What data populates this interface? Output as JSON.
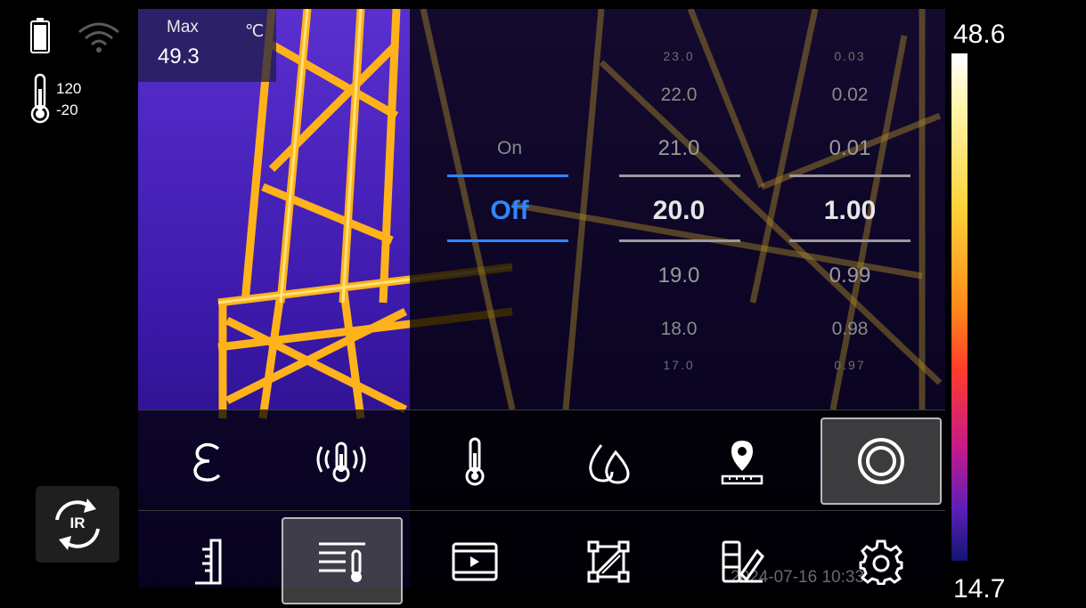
{
  "status": {
    "battery_icon": "battery-icon",
    "wifi_icon": "wifi-icon",
    "range_icon": "thermometer-icon",
    "range_high": "120",
    "range_low": "-20"
  },
  "readout": {
    "label": "Max",
    "value": "49.3",
    "unit": "℃"
  },
  "picker": {
    "toggle": {
      "above": "On",
      "selected": "Off"
    },
    "reflected_temp": {
      "above": [
        "23.0",
        "22.0",
        "21.0"
      ],
      "selected": "20.0",
      "below": [
        "19.0",
        "18.0",
        "17.0"
      ]
    },
    "emissivity": {
      "above": [
        "0.03",
        "0.02",
        "0.01"
      ],
      "selected": "1.00",
      "below": [
        "0.99",
        "0.98",
        "0.97"
      ]
    }
  },
  "colorbar": {
    "max": "48.6",
    "min": "14.7"
  },
  "timestamp": "2024-07-16 10:33",
  "toolbar_top": [
    {
      "icon": "epsilon-emissivity-icon",
      "active": false
    },
    {
      "icon": "reflected-temperature-icon",
      "active": false
    },
    {
      "icon": "thermometer-icon",
      "active": false
    },
    {
      "icon": "humidity-drops-icon",
      "active": false
    },
    {
      "icon": "distance-pin-icon",
      "active": false
    },
    {
      "icon": "toggle-ring-icon",
      "active": true
    }
  ],
  "toolbar_bottom": [
    {
      "icon": "ruler-icon",
      "active": false
    },
    {
      "icon": "measure-params-icon",
      "active": true
    },
    {
      "icon": "video-playback-icon",
      "active": false
    },
    {
      "icon": "image-crop-icon",
      "active": false
    },
    {
      "icon": "palette-edit-icon",
      "active": false
    },
    {
      "icon": "settings-gear-icon",
      "active": false
    }
  ],
  "ir_switch_label": "IR",
  "colors": {
    "accent": "#2f86ff",
    "thermal_bg": "#4a20b8",
    "hot": "#ffb21a"
  }
}
